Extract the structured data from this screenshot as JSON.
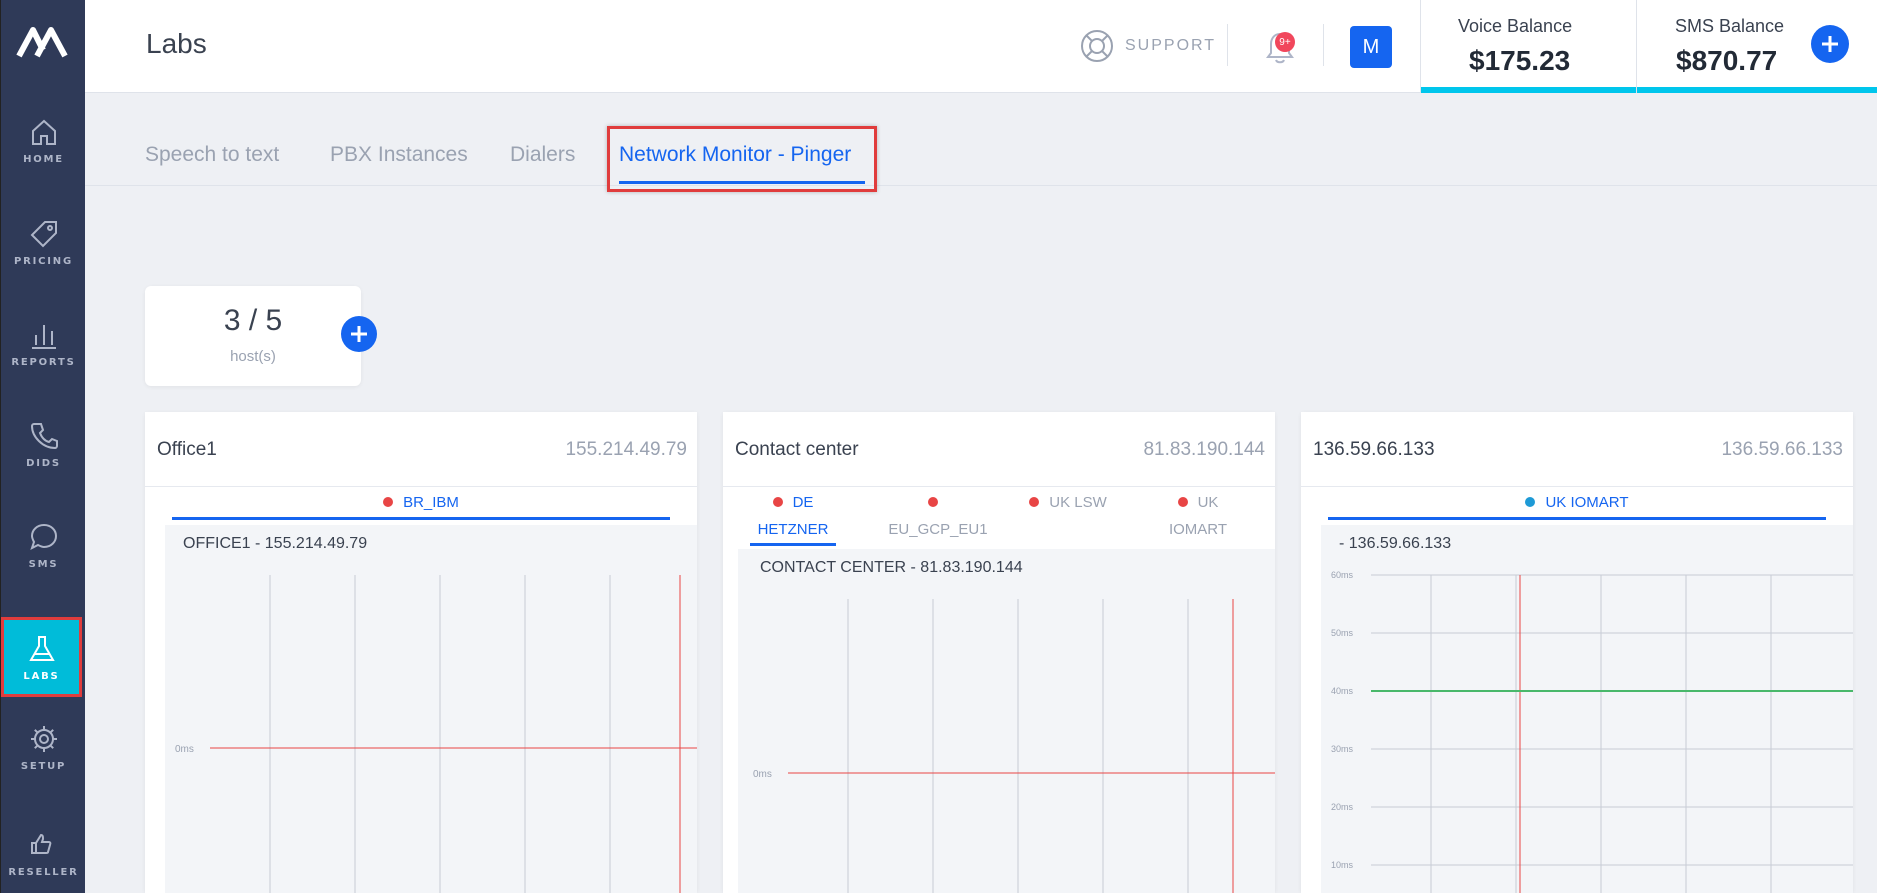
{
  "app": {
    "title": "Labs"
  },
  "sidebar": {
    "items": [
      {
        "label": "HOME",
        "icon": "home-icon"
      },
      {
        "label": "PRICING",
        "icon": "tag-icon"
      },
      {
        "label": "REPORTS",
        "icon": "bar-chart-icon"
      },
      {
        "label": "DIDS",
        "icon": "phone-icon"
      },
      {
        "label": "SMS",
        "icon": "chat-bubble-icon"
      },
      {
        "label": "LABS",
        "icon": "flask-icon",
        "active": true
      },
      {
        "label": "SETUP",
        "icon": "gear-icon"
      },
      {
        "label": "RESELLER",
        "icon": "thumbs-up-icon"
      }
    ]
  },
  "header": {
    "support_label": "SUPPORT",
    "notification_badge": "9+",
    "avatar_initial": "M",
    "voice_balance": {
      "label": "Voice Balance",
      "value": "$175.23"
    },
    "sms_balance": {
      "label": "SMS Balance",
      "value": "$870.77"
    }
  },
  "tabs": [
    {
      "label": "Speech to text"
    },
    {
      "label": "PBX Instances"
    },
    {
      "label": "Dialers"
    },
    {
      "label": "Network Monitor - Pinger",
      "active": true
    }
  ],
  "hosts": {
    "count": "3 / 5",
    "label": "host(s)"
  },
  "panels": [
    {
      "name": "Office1",
      "ip": "155.214.49.79",
      "locations": [
        {
          "label": "BR_IBM",
          "dot_color": "#e84545",
          "active": true
        }
      ],
      "chart_title": "OFFICE1 - 155.214.49.79",
      "y_labels": [
        "0ms"
      ]
    },
    {
      "name": "Contact center",
      "ip": "81.83.190.144",
      "locations": [
        {
          "line1": "DE",
          "line2": "HETZNER",
          "dot_color": "#e84545",
          "active": true
        },
        {
          "line1": "",
          "line2": "EU_GCP_EU1",
          "dot_color": "#e84545",
          "active": false
        },
        {
          "line1": "UK LSW",
          "line2": "",
          "dot_color": "#e84545",
          "active": false
        },
        {
          "line1": "UK",
          "line2": "IOMART",
          "dot_color": "#e84545",
          "active": false
        }
      ],
      "chart_title": "CONTACT CENTER - 81.83.190.144",
      "y_labels": [
        "0ms"
      ]
    },
    {
      "name": "136.59.66.133",
      "ip": "136.59.66.133",
      "locations": [
        {
          "label": "UK IOMART",
          "dot_color": "#1e9ad6",
          "active": true
        }
      ],
      "chart_title": "- 136.59.66.133",
      "y_labels": [
        "60ms",
        "50ms",
        "40ms",
        "30ms",
        "20ms",
        "10ms"
      ]
    }
  ],
  "colors": {
    "accent": "#1565f0",
    "sidebar": "#2f3a58",
    "active_nav": "#00bcd9",
    "balance_bar": "#00c6ec",
    "alert": "#e84545",
    "latency_line": "#49b86b"
  }
}
